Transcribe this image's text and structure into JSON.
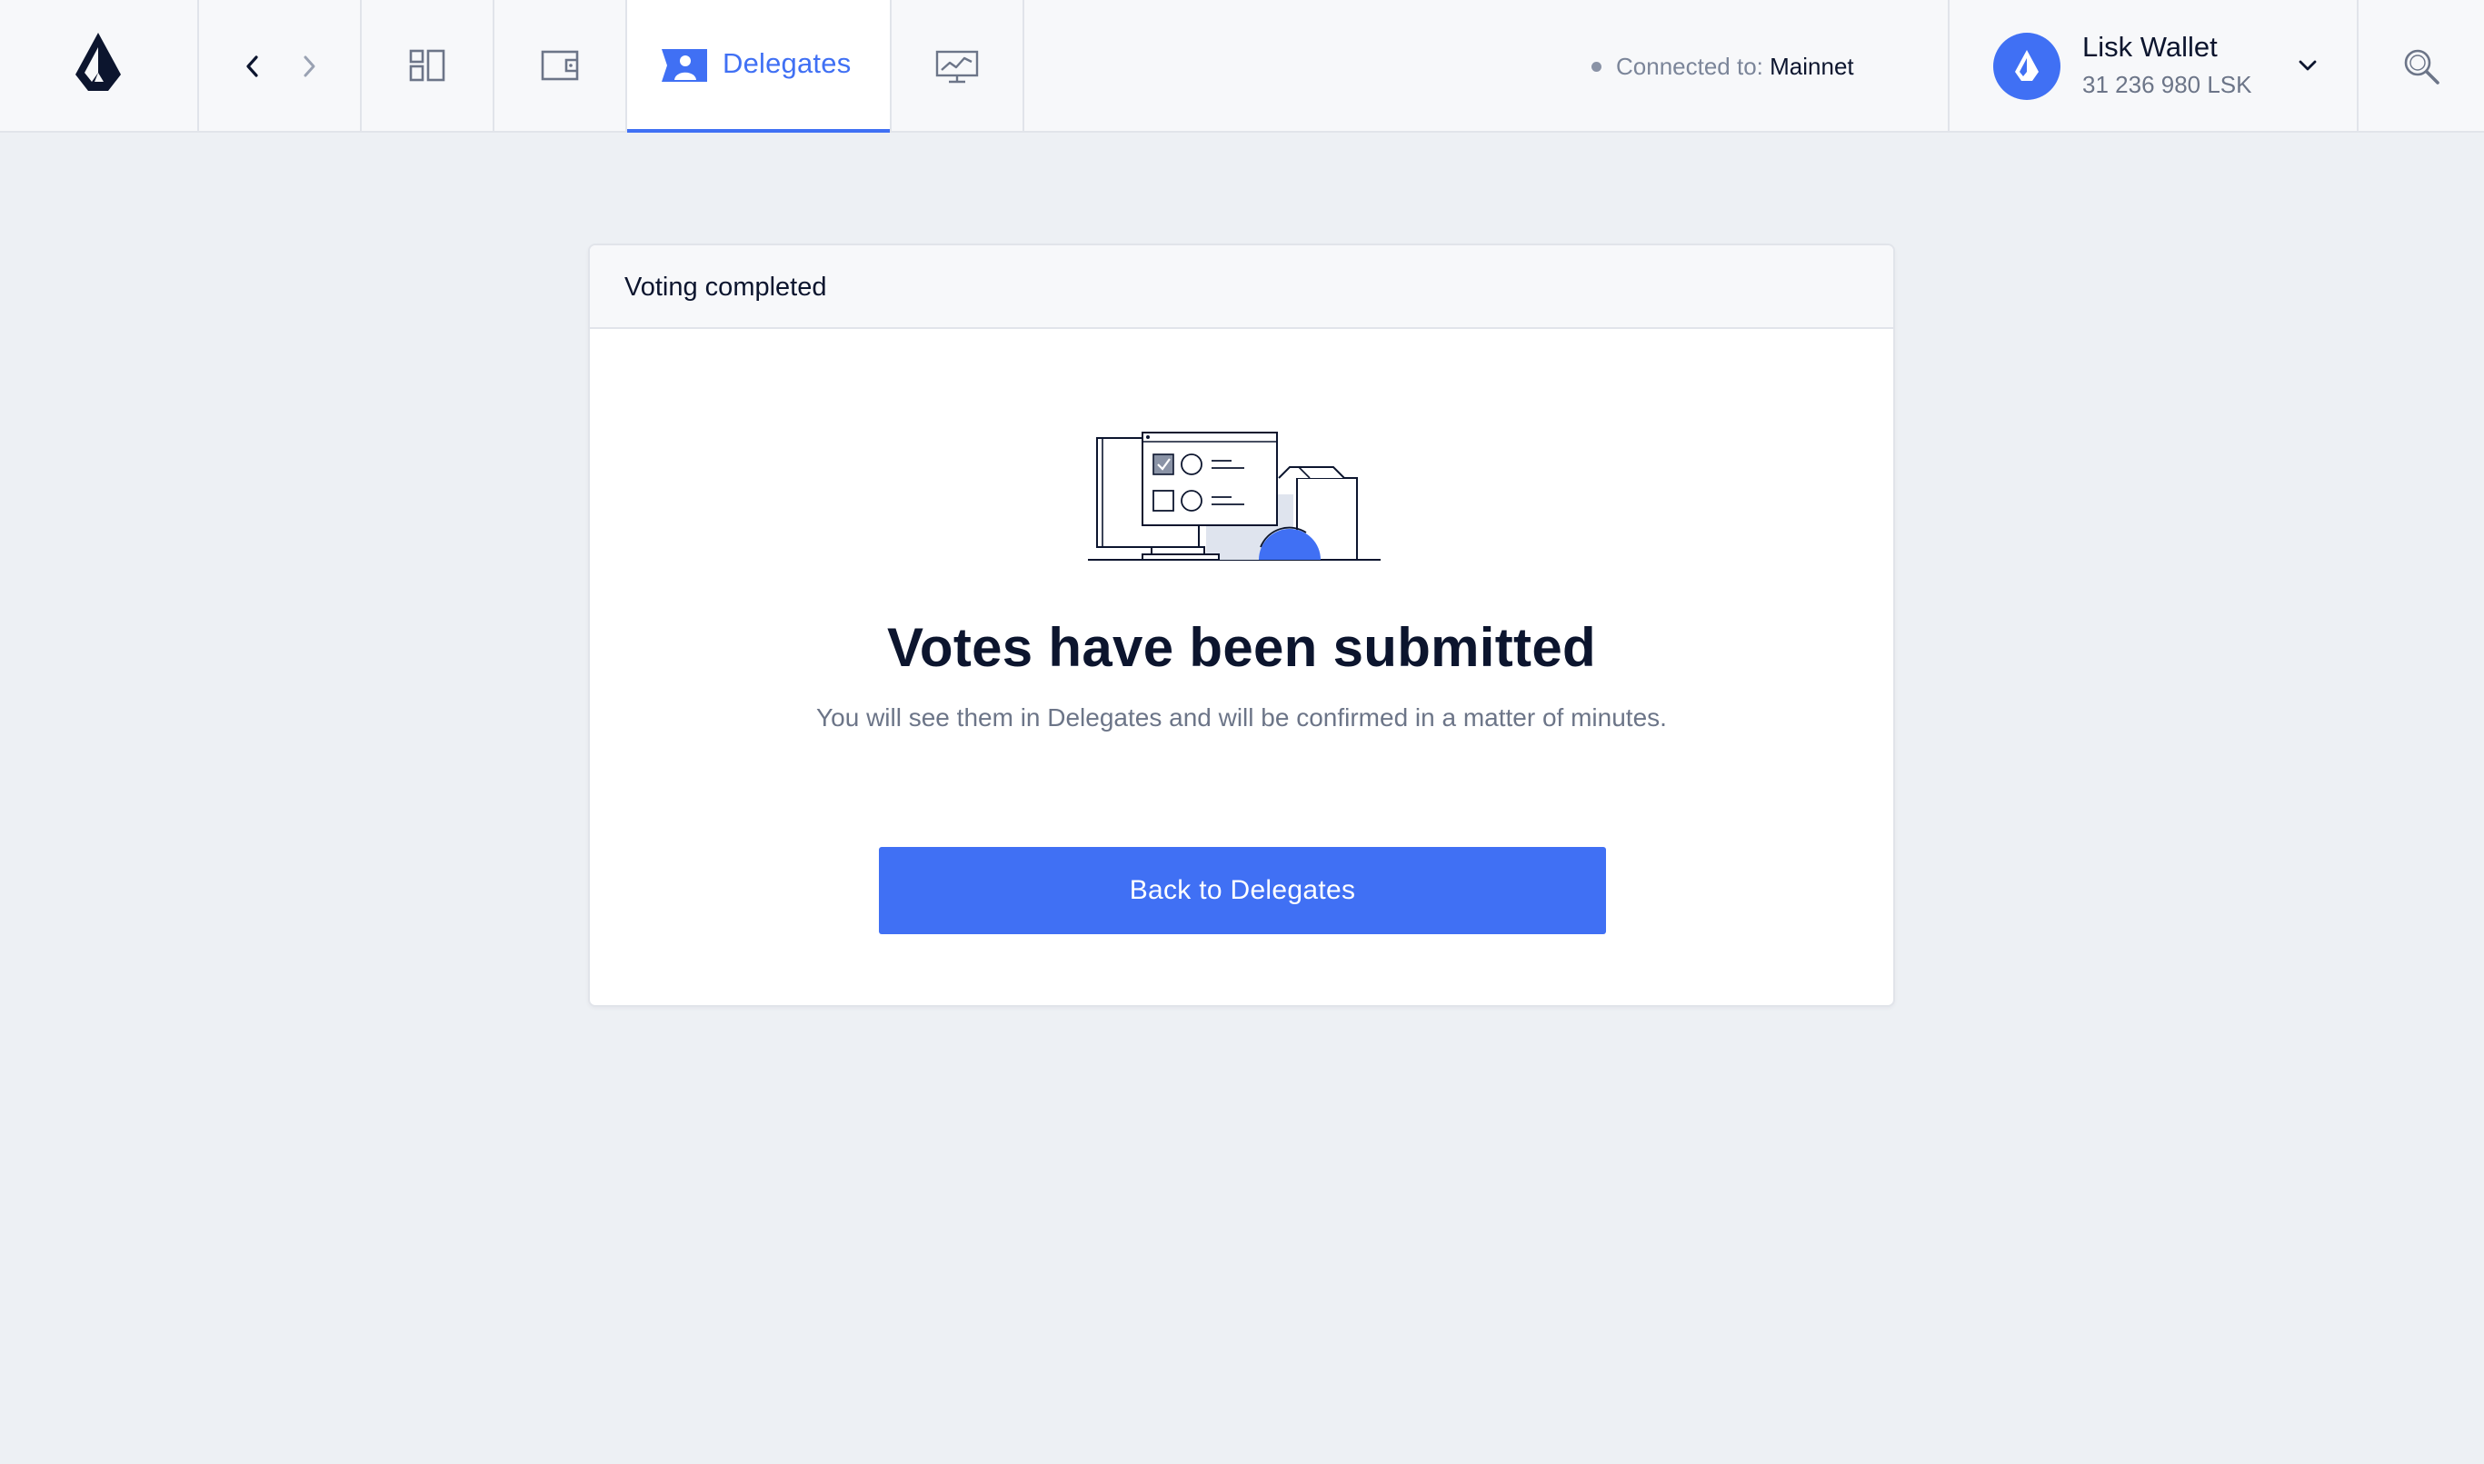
{
  "topbar": {
    "logo_icon": "lisk-logo-icon",
    "nav": {
      "back_icon": "chevron-left-icon",
      "forward_icon": "chevron-right-icon"
    },
    "menu": [
      {
        "id": "dashboard",
        "icon": "dashboard-icon",
        "label": ""
      },
      {
        "id": "wallet",
        "icon": "wallet-icon",
        "label": ""
      },
      {
        "id": "delegates",
        "icon": "delegates-icon",
        "label": "Delegates",
        "active": true
      },
      {
        "id": "monitor",
        "icon": "monitor-chart-icon",
        "label": ""
      }
    ],
    "connection": {
      "prefix": "Connected to:",
      "network": "Mainnet"
    },
    "account": {
      "name": "Lisk Wallet",
      "balance": "31 236 980 LSK",
      "avatar_icon": "lisk-avatar-icon",
      "dropdown_icon": "chevron-down-icon"
    },
    "search_icon": "search-icon"
  },
  "card": {
    "title": "Voting completed",
    "illustration": "voting-computer-illustration",
    "headline": "Votes have been submitted",
    "message": "You will see them in Delegates and will be confirmed in a matter of minutes.",
    "button_label": "Back to Delegates"
  },
  "colors": {
    "accent": "#4070f4",
    "background": "#edf0f4",
    "text_dark": "#0c152e",
    "text_muted": "#6c7588"
  }
}
